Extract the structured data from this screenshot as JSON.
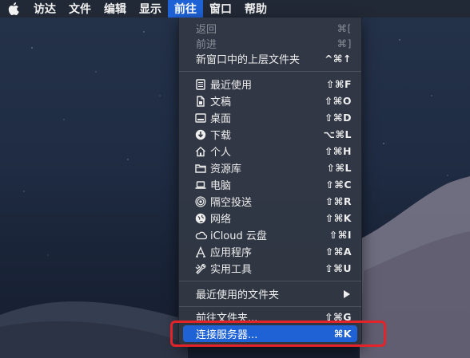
{
  "menubar": {
    "items": [
      "访达",
      "文件",
      "编辑",
      "显示",
      "前往",
      "窗口",
      "帮助"
    ],
    "active_index": 4
  },
  "go_menu": {
    "nav": [
      {
        "label": "返回",
        "shortcut": "⌘[",
        "enabled": false
      },
      {
        "label": "前进",
        "shortcut": "⌘]",
        "enabled": false
      },
      {
        "label": "新窗口中的上层文件夹",
        "shortcut": "^⌘↑",
        "enabled": true
      }
    ],
    "places": [
      {
        "label": "最近使用",
        "shortcut": "⇧⌘F",
        "icon": "recents-icon"
      },
      {
        "label": "文稿",
        "shortcut": "⇧⌘O",
        "icon": "documents-icon"
      },
      {
        "label": "桌面",
        "shortcut": "⇧⌘D",
        "icon": "desktop-icon"
      },
      {
        "label": "下载",
        "shortcut": "⌥⌘L",
        "icon": "downloads-icon"
      },
      {
        "label": "个人",
        "shortcut": "⇧⌘H",
        "icon": "home-icon"
      },
      {
        "label": "资源库",
        "shortcut": "⇧⌘L",
        "icon": "folder-icon"
      },
      {
        "label": "电脑",
        "shortcut": "⇧⌘C",
        "icon": "computer-icon"
      },
      {
        "label": "隔空投送",
        "shortcut": "⇧⌘R",
        "icon": "airdrop-icon"
      },
      {
        "label": "网络",
        "shortcut": "⇧⌘K",
        "icon": "network-icon"
      },
      {
        "label": "iCloud 云盘",
        "shortcut": "⇧⌘I",
        "icon": "icloud-icon"
      },
      {
        "label": "应用程序",
        "shortcut": "⇧⌘A",
        "icon": "applications-icon"
      },
      {
        "label": "实用工具",
        "shortcut": "⇧⌘U",
        "icon": "utilities-icon"
      }
    ],
    "recent_folders": {
      "label": "最近使用的文件夹"
    },
    "goto_folder": {
      "label": "前往文件夹...",
      "shortcut": "⇧⌘G"
    },
    "connect_server": {
      "label": "连接服务器...",
      "shortcut": "⌘K"
    }
  }
}
